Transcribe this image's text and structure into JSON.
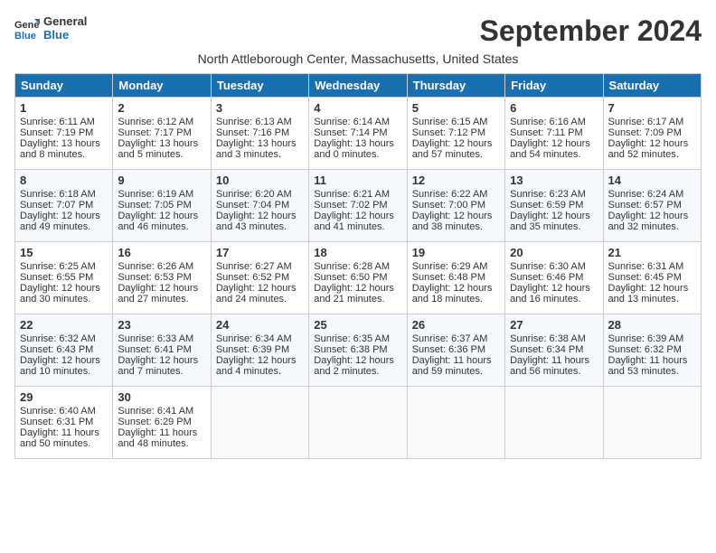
{
  "header": {
    "logo_line1": "General",
    "logo_line2": "Blue",
    "month": "September 2024",
    "location": "North Attleborough Center, Massachusetts, United States"
  },
  "weekdays": [
    "Sunday",
    "Monday",
    "Tuesday",
    "Wednesday",
    "Thursday",
    "Friday",
    "Saturday"
  ],
  "weeks": [
    [
      {
        "day": 1,
        "lines": [
          "Sunrise: 6:11 AM",
          "Sunset: 7:19 PM",
          "Daylight: 13 hours",
          "and 8 minutes."
        ]
      },
      {
        "day": 2,
        "lines": [
          "Sunrise: 6:12 AM",
          "Sunset: 7:17 PM",
          "Daylight: 13 hours",
          "and 5 minutes."
        ]
      },
      {
        "day": 3,
        "lines": [
          "Sunrise: 6:13 AM",
          "Sunset: 7:16 PM",
          "Daylight: 13 hours",
          "and 3 minutes."
        ]
      },
      {
        "day": 4,
        "lines": [
          "Sunrise: 6:14 AM",
          "Sunset: 7:14 PM",
          "Daylight: 13 hours",
          "and 0 minutes."
        ]
      },
      {
        "day": 5,
        "lines": [
          "Sunrise: 6:15 AM",
          "Sunset: 7:12 PM",
          "Daylight: 12 hours",
          "and 57 minutes."
        ]
      },
      {
        "day": 6,
        "lines": [
          "Sunrise: 6:16 AM",
          "Sunset: 7:11 PM",
          "Daylight: 12 hours",
          "and 54 minutes."
        ]
      },
      {
        "day": 7,
        "lines": [
          "Sunrise: 6:17 AM",
          "Sunset: 7:09 PM",
          "Daylight: 12 hours",
          "and 52 minutes."
        ]
      }
    ],
    [
      {
        "day": 8,
        "lines": [
          "Sunrise: 6:18 AM",
          "Sunset: 7:07 PM",
          "Daylight: 12 hours",
          "and 49 minutes."
        ]
      },
      {
        "day": 9,
        "lines": [
          "Sunrise: 6:19 AM",
          "Sunset: 7:05 PM",
          "Daylight: 12 hours",
          "and 46 minutes."
        ]
      },
      {
        "day": 10,
        "lines": [
          "Sunrise: 6:20 AM",
          "Sunset: 7:04 PM",
          "Daylight: 12 hours",
          "and 43 minutes."
        ]
      },
      {
        "day": 11,
        "lines": [
          "Sunrise: 6:21 AM",
          "Sunset: 7:02 PM",
          "Daylight: 12 hours",
          "and 41 minutes."
        ]
      },
      {
        "day": 12,
        "lines": [
          "Sunrise: 6:22 AM",
          "Sunset: 7:00 PM",
          "Daylight: 12 hours",
          "and 38 minutes."
        ]
      },
      {
        "day": 13,
        "lines": [
          "Sunrise: 6:23 AM",
          "Sunset: 6:59 PM",
          "Daylight: 12 hours",
          "and 35 minutes."
        ]
      },
      {
        "day": 14,
        "lines": [
          "Sunrise: 6:24 AM",
          "Sunset: 6:57 PM",
          "Daylight: 12 hours",
          "and 32 minutes."
        ]
      }
    ],
    [
      {
        "day": 15,
        "lines": [
          "Sunrise: 6:25 AM",
          "Sunset: 6:55 PM",
          "Daylight: 12 hours",
          "and 30 minutes."
        ]
      },
      {
        "day": 16,
        "lines": [
          "Sunrise: 6:26 AM",
          "Sunset: 6:53 PM",
          "Daylight: 12 hours",
          "and 27 minutes."
        ]
      },
      {
        "day": 17,
        "lines": [
          "Sunrise: 6:27 AM",
          "Sunset: 6:52 PM",
          "Daylight: 12 hours",
          "and 24 minutes."
        ]
      },
      {
        "day": 18,
        "lines": [
          "Sunrise: 6:28 AM",
          "Sunset: 6:50 PM",
          "Daylight: 12 hours",
          "and 21 minutes."
        ]
      },
      {
        "day": 19,
        "lines": [
          "Sunrise: 6:29 AM",
          "Sunset: 6:48 PM",
          "Daylight: 12 hours",
          "and 18 minutes."
        ]
      },
      {
        "day": 20,
        "lines": [
          "Sunrise: 6:30 AM",
          "Sunset: 6:46 PM",
          "Daylight: 12 hours",
          "and 16 minutes."
        ]
      },
      {
        "day": 21,
        "lines": [
          "Sunrise: 6:31 AM",
          "Sunset: 6:45 PM",
          "Daylight: 12 hours",
          "and 13 minutes."
        ]
      }
    ],
    [
      {
        "day": 22,
        "lines": [
          "Sunrise: 6:32 AM",
          "Sunset: 6:43 PM",
          "Daylight: 12 hours",
          "and 10 minutes."
        ]
      },
      {
        "day": 23,
        "lines": [
          "Sunrise: 6:33 AM",
          "Sunset: 6:41 PM",
          "Daylight: 12 hours",
          "and 7 minutes."
        ]
      },
      {
        "day": 24,
        "lines": [
          "Sunrise: 6:34 AM",
          "Sunset: 6:39 PM",
          "Daylight: 12 hours",
          "and 4 minutes."
        ]
      },
      {
        "day": 25,
        "lines": [
          "Sunrise: 6:35 AM",
          "Sunset: 6:38 PM",
          "Daylight: 12 hours",
          "and 2 minutes."
        ]
      },
      {
        "day": 26,
        "lines": [
          "Sunrise: 6:37 AM",
          "Sunset: 6:36 PM",
          "Daylight: 11 hours",
          "and 59 minutes."
        ]
      },
      {
        "day": 27,
        "lines": [
          "Sunrise: 6:38 AM",
          "Sunset: 6:34 PM",
          "Daylight: 11 hours",
          "and 56 minutes."
        ]
      },
      {
        "day": 28,
        "lines": [
          "Sunrise: 6:39 AM",
          "Sunset: 6:32 PM",
          "Daylight: 11 hours",
          "and 53 minutes."
        ]
      }
    ],
    [
      {
        "day": 29,
        "lines": [
          "Sunrise: 6:40 AM",
          "Sunset: 6:31 PM",
          "Daylight: 11 hours",
          "and 50 minutes."
        ]
      },
      {
        "day": 30,
        "lines": [
          "Sunrise: 6:41 AM",
          "Sunset: 6:29 PM",
          "Daylight: 11 hours",
          "and 48 minutes."
        ]
      },
      null,
      null,
      null,
      null,
      null
    ]
  ]
}
